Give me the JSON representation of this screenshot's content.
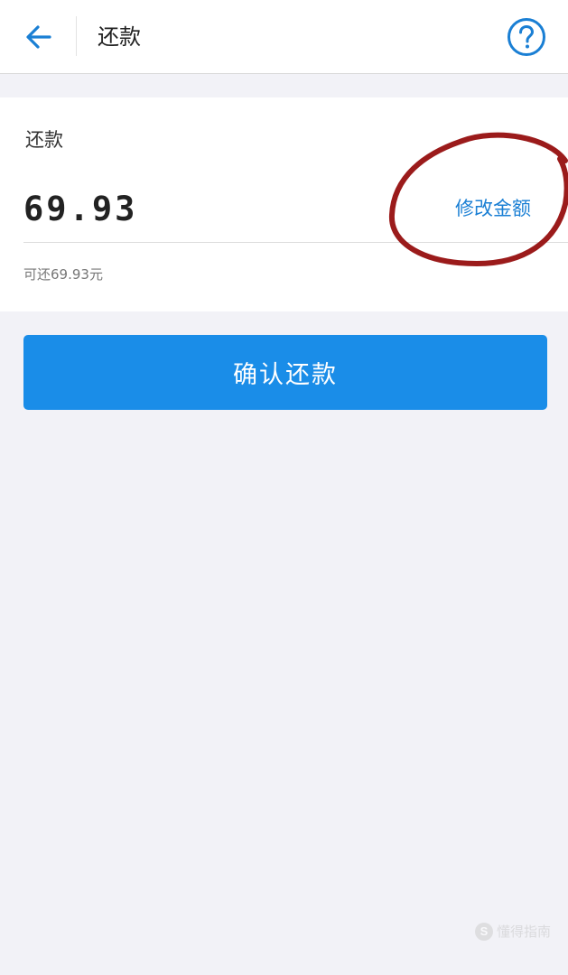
{
  "header": {
    "title": "还款",
    "back_icon": "arrow-left-icon",
    "help_icon": "question-circle-icon"
  },
  "repayment": {
    "label": "还款",
    "amount": "69.93",
    "modify_link": "修改金额",
    "available_text": "可还69.93元"
  },
  "actions": {
    "confirm_label": "确认还款"
  },
  "watermark": {
    "logo_letter": "S",
    "text": "懂得指南"
  },
  "colors": {
    "accent": "#1a8de8",
    "link": "#1a7fd4",
    "annotation": "#9b1b1b",
    "background": "#f2f2f7"
  }
}
